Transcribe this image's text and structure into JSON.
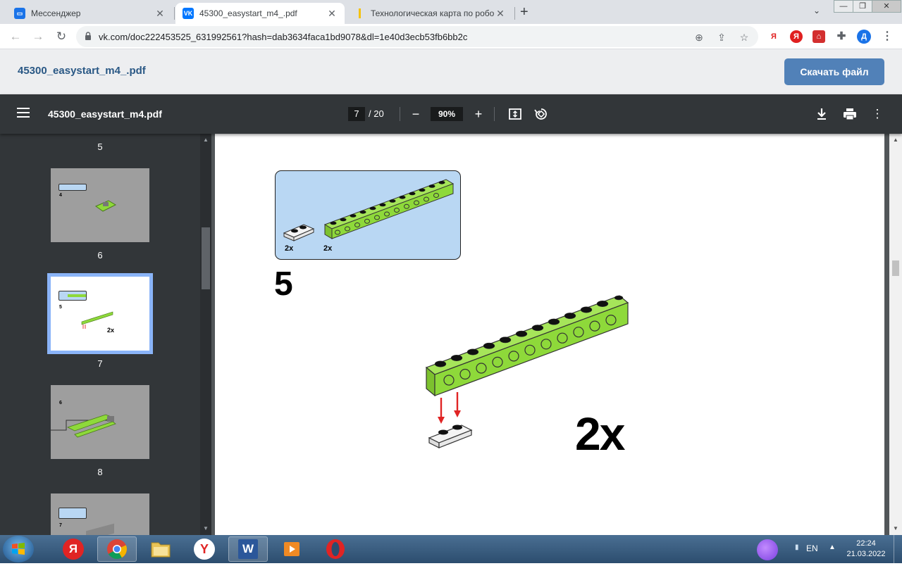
{
  "browser": {
    "tabs": [
      {
        "title": "Мессенджер",
        "favicon": "messenger-icon",
        "active": false
      },
      {
        "title": "45300_easystart_m4_.pdf",
        "favicon": "vk-icon",
        "active": true
      },
      {
        "title": "Технологическая карта по робо",
        "favicon": "doc-icon",
        "active": false
      }
    ],
    "url": "vk.com/doc222453525_631992561?hash=dab3634faca1bd9078&dl=1e40d3ecb53fb6bb2c",
    "profile_initial": "Д",
    "ext_ya_label": "Я"
  },
  "vk": {
    "doc_title": "45300_easystart_m4_.pdf",
    "download_label": "Скачать файл"
  },
  "pdf": {
    "file_name": "45300_easystart_m4.pdf",
    "current_page": "7",
    "total_pages": "/ 20",
    "zoom": "90%",
    "thumbnails": [
      {
        "page": "5",
        "step": ""
      },
      {
        "page": "6",
        "step": "4"
      },
      {
        "page": "7",
        "step": "5",
        "count": "2x"
      },
      {
        "page": "8",
        "step": "6"
      },
      {
        "page": "",
        "step": "7"
      }
    ],
    "content": {
      "step_number": "5",
      "parts": [
        {
          "qty": "2x",
          "name": "plate-1x2"
        },
        {
          "qty": "2x",
          "name": "technic-beam-1x12"
        }
      ],
      "multiplier": "2x"
    }
  },
  "taskbar": {
    "lang": "EN",
    "time": "22:24",
    "date": "21.03.2022",
    "yandex_letter": "Я",
    "word_letter": "W"
  },
  "colors": {
    "vk_blue": "#5181b8",
    "pdf_toolbar": "#323639",
    "lego_green": "#8ed93a",
    "parts_box": "#b9d7f3",
    "arrow_red": "#e02424"
  }
}
